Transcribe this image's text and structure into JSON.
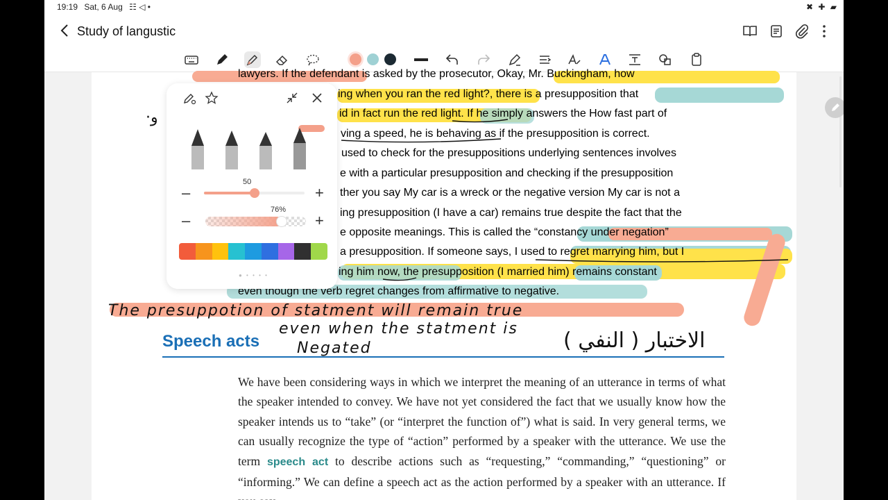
{
  "status_bar": {
    "time": "19:19",
    "date": "Sat, 6 Aug",
    "notification_icons": "☷ ◁ •",
    "system_icons": "✖ ✚ ▰"
  },
  "app_bar": {
    "title": "Study of langustic",
    "icons": [
      "book-icon",
      "page-view-icon",
      "attach-icon",
      "more-options-icon"
    ]
  },
  "toolbar": {
    "tools": [
      "keyboard-icon",
      "pen-icon",
      "highlighter-icon",
      "eraser-icon",
      "lasso-icon"
    ],
    "active_tool": "highlighter-icon",
    "swatches": [
      "#f4a08a",
      "#9fd1d4",
      "#1c2a33"
    ],
    "selected_swatch": "#f4a08a",
    "right_tools": [
      "line-thickness-icon",
      "undo-icon",
      "redo-icon",
      "pen-to-text-icon",
      "straighten-icon",
      "handwriting-icon",
      "ai-text-icon",
      "text-box-icon",
      "shapes-icon",
      "clipboard-icon"
    ]
  },
  "pen_popup": {
    "size_value": "50",
    "size_level": 0.5,
    "opacity_value": "76%",
    "opacity_level": 0.76,
    "pen_types": [
      "fountain-pen",
      "calligraphy-pen",
      "pencil-pen",
      "highlighter-pen"
    ],
    "palette": [
      "#f25c3b",
      "#f7941d",
      "#ffc20e",
      "#27c1d1",
      "#1e9be0",
      "#2f6fe0",
      "#a666e8",
      "#303030",
      "#a0d84a"
    ]
  },
  "document": {
    "lines": [
      "lawyers. If the defendant is asked by the prosecutor, Okay, Mr. Buckingham, how",
      "ing when you ran the red light?, there is a presupposition that",
      "id in fact run the red light. If he simply answers the How fast part of",
      "ving a speed, he is behaving as if the presupposition is correct.",
      "used to check for the presuppositions underlying sentences involves",
      "e with a particular presupposition and checking if the presupposition",
      "ther you say My car is a wreck or the negative version My car is not a",
      "ing presupposition (I have a car) remains true despite the fact that the",
      "e opposite meanings. This is called the “constancy under negation”",
      "a presupposition. If someone says, I used to regret marrying him, but I",
      "ing him now, the presupposition (I married him) remains constant",
      "even though the verb regret changes from affirmative to negative."
    ],
    "section_heading": "Speech acts",
    "body_paragraph": [
      "We have been considering ways in which we interpret the meaning of an utterance in terms of what the speaker intended to convey. We have not yet considered the fact that we usually know how the speaker intends us to “take” (or “interpret the function of”) what is said. In very general terms, we can usually recognize the type of “action” performed by a speaker with the utterance. We use the term ",
      "speech act",
      " to describe actions such as “requesting,” “commanding,” “questioning” or “informing.” We can define a speech act as the action performed by a speaker with an utterance. If you say"
    ]
  },
  "handwriting": {
    "note_line_1": "The presuppotion of statment will remain true",
    "note_line_2": "even when the statment is",
    "note_line_3": "Negated",
    "arabic_note": "( النفي ) الاختبار",
    "margin_mark": "·و"
  }
}
